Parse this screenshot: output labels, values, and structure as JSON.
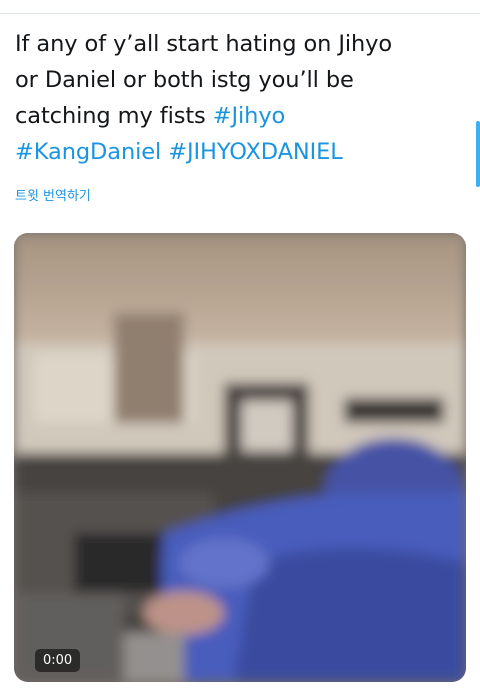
{
  "tweet": {
    "text_lines": [
      "If any of y’all start hating on Jihyo",
      "or Daniel or both istg you’ll be",
      "catching my fists "
    ],
    "hashtags": [
      "#Jihyo",
      "#KangDaniel",
      "#JIHYOXDANIEL"
    ],
    "translate_label": "트윗 번역하기"
  },
  "media": {
    "type": "video",
    "timestamp": "0:00"
  },
  "colors": {
    "text": "#14171a",
    "link": "#1b95e0",
    "scroll_indicator": "#1da1f2"
  }
}
